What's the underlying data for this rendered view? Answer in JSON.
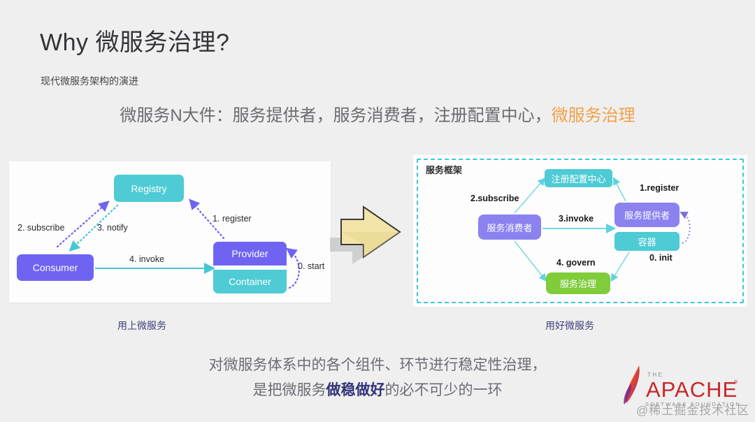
{
  "slide": {
    "title": "Why 微服务治理?",
    "subtitle": "现代微服务架构的演进",
    "headline_main": "微服务N大件：服务提供者，服务消费者，注册配置中心，",
    "headline_accent": "微服务治理",
    "accent_color": "#f0a04b",
    "background_color": "#efefef"
  },
  "left_diagram": {
    "caption": "用上微服务",
    "nodes": {
      "registry": "Registry",
      "consumer": "Consumer",
      "provider": "Provider",
      "container": "Container"
    },
    "edges": {
      "subscribe": "2. subscribe",
      "notify": "3. notify",
      "register": "1. register",
      "invoke": "4. invoke",
      "start": "0. start"
    },
    "colors": {
      "teal": "#4ecbd4",
      "purple": "#6f64f2"
    }
  },
  "right_diagram": {
    "caption": "用好微服务",
    "frame_label": "服务框架",
    "nodes": {
      "registry": "注册配置中心",
      "consumer": "服务消费者",
      "provider": "服务提供者",
      "container": "容器",
      "governance": "服务治理"
    },
    "edges": {
      "subscribe": "2.subscribe",
      "register": "1.register",
      "invoke": "3.invoke",
      "govern": "4. govern",
      "init": "0. init"
    },
    "colors": {
      "teal": "#4ecbd4",
      "purple": "#8b82f0",
      "green": "#80cc3b",
      "frame_border": "#3ec8d8"
    }
  },
  "footer": {
    "line1": "对微服务体系中的各个组件、环节进行稳定性治理，",
    "line2_pre": "是把微服务",
    "line2_strong": "做稳做好",
    "line2_post": "的必不可少的一环",
    "logo_the": "THE",
    "logo_name": "APACHE",
    "logo_reg": "®",
    "logo_tagline": "SOFTWARE FOUNDATION",
    "watermark": "@稀土掘金技术社区"
  }
}
